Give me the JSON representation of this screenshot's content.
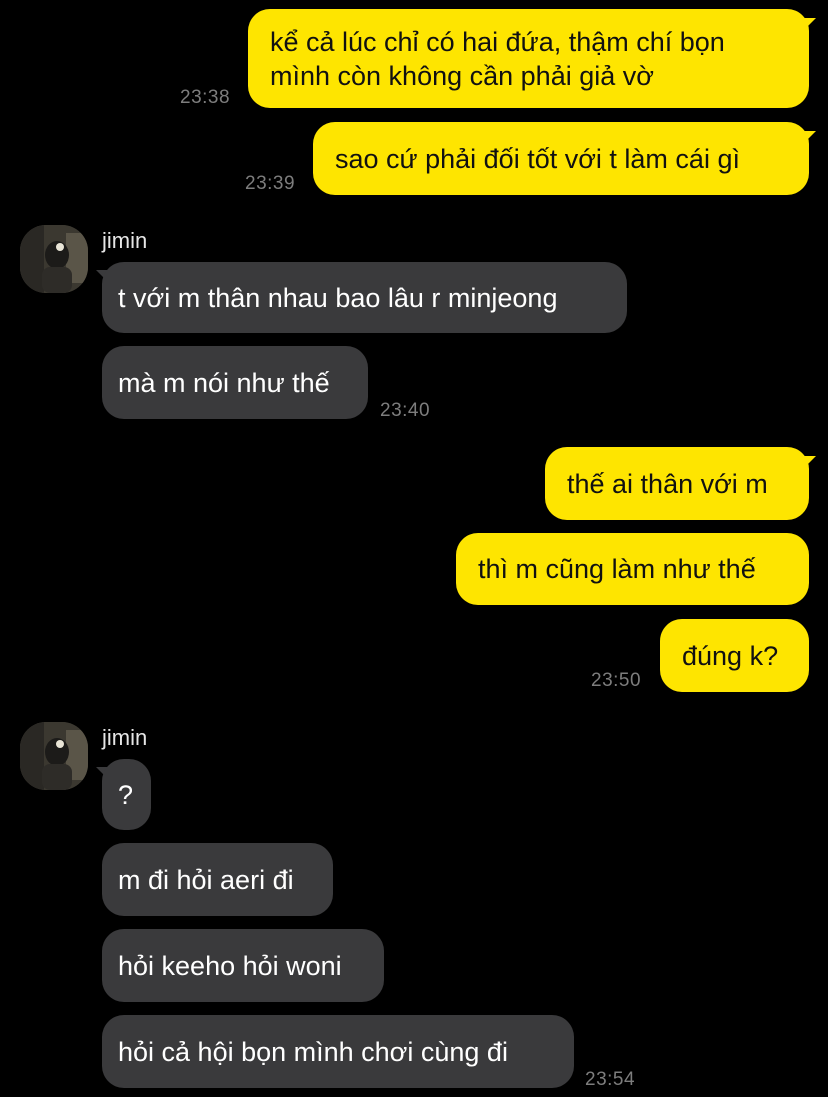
{
  "colors": {
    "background": "#000000",
    "outgoing_bubble": "#fee500",
    "incoming_bubble": "#3a3a3c",
    "timestamp": "#7d7d7d"
  },
  "outgoing_group_1": {
    "messages": [
      "kể cả lúc chỉ có hai đứa, thậm chí bọn mình còn không cần phải giả vờ"
    ],
    "time": "23:38"
  },
  "outgoing_group_2": {
    "messages": [
      "sao cứ phải đối tốt với t làm cái gì"
    ],
    "time": "23:39"
  },
  "incoming_group_1": {
    "sender": "jimin",
    "avatar_icon": "profile-photo",
    "messages": [
      "t với m thân nhau bao lâu r minjeong",
      "mà m nói như thế"
    ],
    "time": "23:40"
  },
  "outgoing_group_3": {
    "messages": [
      "thế ai thân với m",
      "thì m cũng làm như thế",
      "đúng k?"
    ],
    "time": "23:50"
  },
  "incoming_group_2": {
    "sender": "jimin",
    "avatar_icon": "profile-photo",
    "messages": [
      "?",
      "m đi hỏi aeri đi",
      "hỏi keeho hỏi woni",
      "hỏi cả hội bọn mình chơi cùng đi"
    ],
    "time": "23:54"
  }
}
